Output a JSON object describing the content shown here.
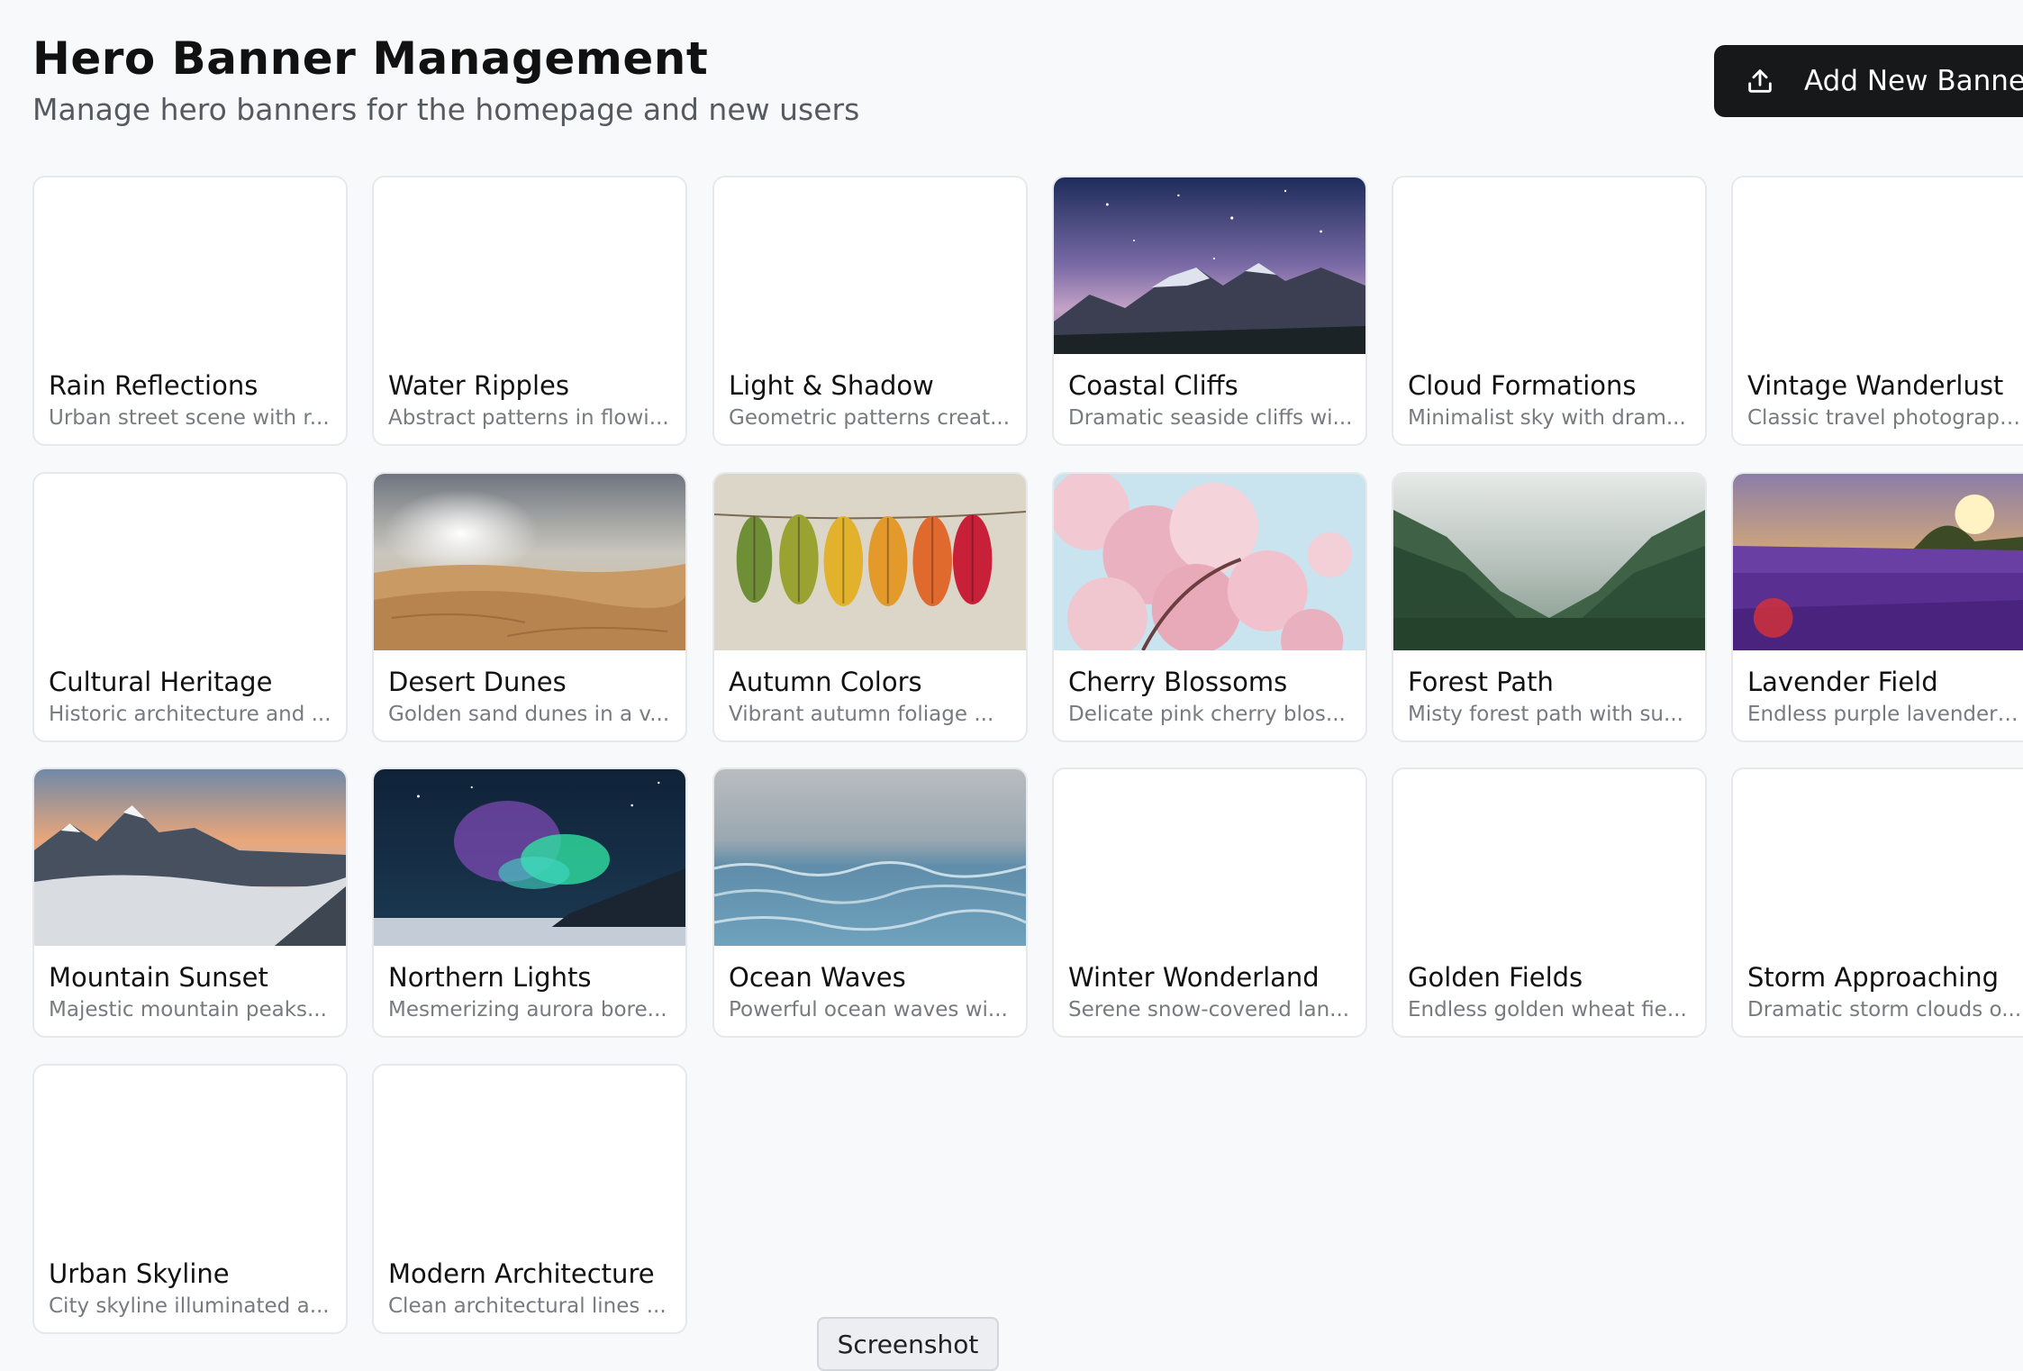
{
  "header": {
    "title": "Hero Banner Management",
    "subtitle": "Manage hero banners for the homepage and new users",
    "add_button_label": "Add New Banner",
    "add_button_icon": "upload-icon"
  },
  "colors": {
    "background": "#f8f9fb",
    "button_bg": "#17181a",
    "card_border": "#e6e8ec",
    "description_text": "#777b80"
  },
  "banners": [
    {
      "title": "Rain Reflections",
      "description": "Urban street scene with r...",
      "image": "none"
    },
    {
      "title": "Water Ripples",
      "description": "Abstract patterns in flowi...",
      "image": "none"
    },
    {
      "title": "Light & Shadow",
      "description": "Geometric patterns creat...",
      "image": "none"
    },
    {
      "title": "Coastal Cliffs",
      "description": "Dramatic seaside cliffs wi...",
      "image": "starry-mountains"
    },
    {
      "title": "Cloud Formations",
      "description": "Minimalist sky with dram...",
      "image": "none"
    },
    {
      "title": "Vintage Wanderlust",
      "description": "Classic travel photograph...",
      "image": "none"
    },
    {
      "title": "Cultural Heritage",
      "description": "Historic architecture and ...",
      "image": "none"
    },
    {
      "title": "Desert Dunes",
      "description": "Golden sand dunes in a v...",
      "image": "desert-dunes"
    },
    {
      "title": "Autumn Colors",
      "description": "Vibrant autumn foliage ...",
      "image": "autumn-leaves"
    },
    {
      "title": "Cherry Blossoms",
      "description": "Delicate pink cherry blos...",
      "image": "cherry-blossoms"
    },
    {
      "title": "Forest Path",
      "description": "Misty forest path with su...",
      "image": "misty-forest"
    },
    {
      "title": "Lavender Field",
      "description": "Endless purple lavender ...",
      "image": "lavender-field"
    },
    {
      "title": "Mountain Sunset",
      "description": "Majestic mountain peaks...",
      "image": "mountain-sunset"
    },
    {
      "title": "Northern Lights",
      "description": "Mesmerizing aurora bore...",
      "image": "aurora"
    },
    {
      "title": "Ocean Waves",
      "description": "Powerful ocean waves wi...",
      "image": "ocean-water"
    },
    {
      "title": "Winter Wonderland",
      "description": "Serene snow-covered lan...",
      "image": "none"
    },
    {
      "title": "Golden Fields",
      "description": "Endless golden wheat fie...",
      "image": "none"
    },
    {
      "title": "Storm Approaching",
      "description": "Dramatic storm clouds o...",
      "image": "none"
    },
    {
      "title": "Urban Skyline",
      "description": "City skyline illuminated a...",
      "image": "none"
    },
    {
      "title": "Modern Architecture",
      "description": "Clean architectural lines ...",
      "image": "none"
    }
  ],
  "tooltip": {
    "label": "Screenshot"
  }
}
